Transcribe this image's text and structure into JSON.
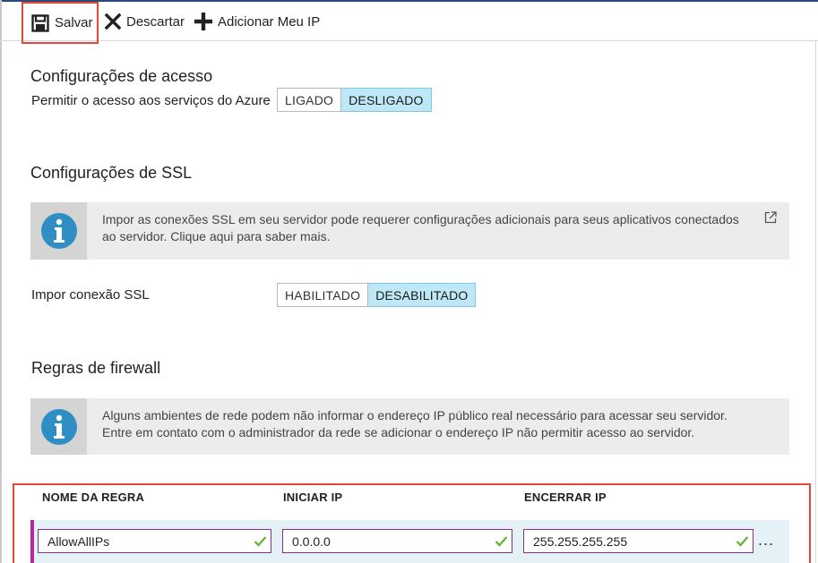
{
  "toolbar": {
    "save_label": "Salvar",
    "discard_label": "Descartar",
    "add_ip_label": "Adicionar Meu IP"
  },
  "access": {
    "title": "Configurações de acesso",
    "allow_label": "Permitir o acesso aos serviços do Azure",
    "on_label": "LIGADO",
    "off_label": "DESLIGADO",
    "selected": "DESLIGADO"
  },
  "ssl": {
    "title": "Configurações de SSL",
    "info_text": "Impor as conexões SSL em seu servidor pode requerer configurações adicionais para seus aplicativos conectados ao servidor. Clique aqui para saber mais.",
    "enforce_label": "Impor conexão SSL",
    "enabled_label": "HABILITADO",
    "disabled_label": "DESABILITADO",
    "selected": "DESABILITADO"
  },
  "firewall": {
    "title": "Regras de firewall",
    "info_text": "Alguns ambientes de rede podem não informar o endereço IP público real necessário para acessar seu servidor. Entre em contato com o administrador da rede se adicionar o endereço IP não permitir acesso ao servidor.",
    "columns": [
      "NOME DA REGRA",
      "INICIAR IP",
      "ENCERRAR IP"
    ],
    "rows": [
      {
        "rule_name": "AllowAllIPs",
        "start_ip": "0.0.0.0",
        "end_ip": "255.255.255.255"
      }
    ],
    "more_label": "..."
  },
  "colors": {
    "highlight_border": "#e0483a",
    "toggle_active": "#bfe8f6",
    "info_icon": "#2f8fc4",
    "valid_check": "#5cb82e",
    "row_marker": "#b5279d"
  }
}
